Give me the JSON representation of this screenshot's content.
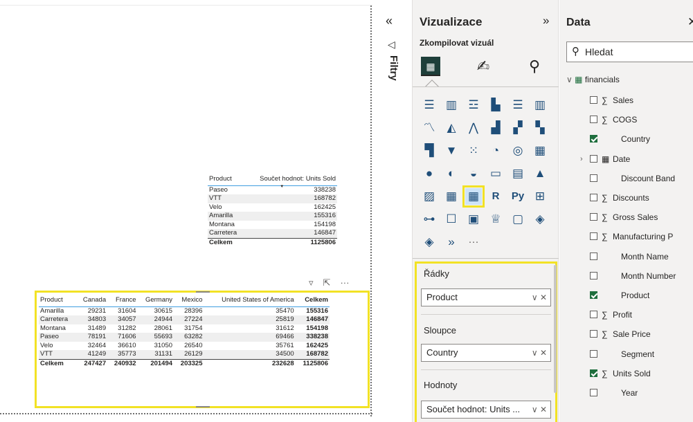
{
  "matrix_small": {
    "headers": [
      "Product",
      "Součet hodnot: Units Sold"
    ],
    "rows": [
      {
        "product": "Paseo",
        "value": "338238"
      },
      {
        "product": "VTT",
        "value": "168782"
      },
      {
        "product": "Velo",
        "value": "162425"
      },
      {
        "product": "Amarilla",
        "value": "155316"
      },
      {
        "product": "Montana",
        "value": "154198"
      },
      {
        "product": "Carretera",
        "value": "146847"
      }
    ],
    "total": {
      "label": "Celkem",
      "value": "1125806"
    },
    "icons": [
      "filter-icon",
      "focus-mode-icon",
      "more-options-icon"
    ],
    "more_glyph": "···"
  },
  "matrix_main": {
    "headers": [
      "Product",
      "Canada",
      "France",
      "Germany",
      "Mexico",
      "United States of America",
      "Celkem"
    ],
    "rows": [
      [
        "Amarilla",
        "29231",
        "31604",
        "30615",
        "28396",
        "35470",
        "155316"
      ],
      [
        "Carretera",
        "34803",
        "34057",
        "24944",
        "27224",
        "25819",
        "146847"
      ],
      [
        "Montana",
        "31489",
        "31282",
        "28061",
        "31754",
        "31612",
        "154198"
      ],
      [
        "Paseo",
        "78191",
        "71606",
        "55693",
        "63282",
        "69466",
        "338238"
      ],
      [
        "Velo",
        "32464",
        "36610",
        "31050",
        "26540",
        "35761",
        "162425"
      ],
      [
        "VTT",
        "41249",
        "35773",
        "31131",
        "26129",
        "34500",
        "168782"
      ]
    ],
    "total": [
      "Celkem",
      "247427",
      "240932",
      "201494",
      "203325",
      "232628",
      "1125806"
    ]
  },
  "filters": {
    "label": "Filtry",
    "collapse_glyph": "«",
    "icon": "filter-icon"
  },
  "viz": {
    "title": "Vizualizace",
    "expand_glyph": "»",
    "subtitle": "Zkompilovat vizuál",
    "visual_icons": [
      "stacked-bar-icon",
      "stacked-column-icon",
      "clustered-bar-icon",
      "clustered-column-icon",
      "100-bar-icon",
      "100-column-icon",
      "line-icon",
      "area-icon",
      "stacked-area-icon",
      "line-column-icon",
      "line-clustered-column-icon",
      "ribbon-icon",
      "waterfall-icon",
      "funnel-icon",
      "scatter-icon",
      "pie-icon",
      "donut-icon",
      "treemap-icon",
      "map-icon",
      "filled-map-icon",
      "gauge-icon",
      "card-icon",
      "multirow-card-icon",
      "kpi-icon",
      "slicer-icon",
      "table-icon",
      "matrix-icon",
      "r-visual-icon",
      "python-visual-icon",
      "key-influencers-icon",
      "decomposition-tree-icon",
      "qna-icon",
      "paginated-report-icon",
      "trophy-icon",
      "smart-narrative-icon",
      "power-apps-icon",
      "power-automate-icon",
      "more-visuals-icon",
      "more-icon"
    ],
    "wells": {
      "rows_label": "Řádky",
      "rows_value": "Product",
      "cols_label": "Sloupce",
      "cols_value": "Country",
      "values_label": "Hodnoty",
      "values_value": "Součet hodnot: Units ...",
      "controls": "∨ ✕"
    }
  },
  "data": {
    "title": "Data",
    "close_glyph": "✕",
    "search_placeholder": "Hledat",
    "table_name": "financials",
    "fields": [
      {
        "name": "Sales",
        "sigma": true,
        "checked": false
      },
      {
        "name": "COGS",
        "sigma": true,
        "checked": false
      },
      {
        "name": "Country",
        "sigma": false,
        "checked": true
      },
      {
        "name": "Date",
        "sigma": false,
        "checked": false,
        "calendar": true
      },
      {
        "name": "Discount Band",
        "sigma": false,
        "checked": false
      },
      {
        "name": "Discounts",
        "sigma": true,
        "checked": false
      },
      {
        "name": "Gross Sales",
        "sigma": true,
        "checked": false
      },
      {
        "name": "Manufacturing P",
        "sigma": true,
        "checked": false
      },
      {
        "name": "Month Name",
        "sigma": false,
        "checked": false
      },
      {
        "name": "Month Number",
        "sigma": false,
        "checked": false
      },
      {
        "name": "Product",
        "sigma": false,
        "checked": true
      },
      {
        "name": "Profit",
        "sigma": true,
        "checked": false
      },
      {
        "name": "Sale Price",
        "sigma": true,
        "checked": false
      },
      {
        "name": "Segment",
        "sigma": false,
        "checked": false
      },
      {
        "name": "Units Sold",
        "sigma": true,
        "checked": true
      },
      {
        "name": "Year",
        "sigma": false,
        "checked": false
      }
    ]
  }
}
